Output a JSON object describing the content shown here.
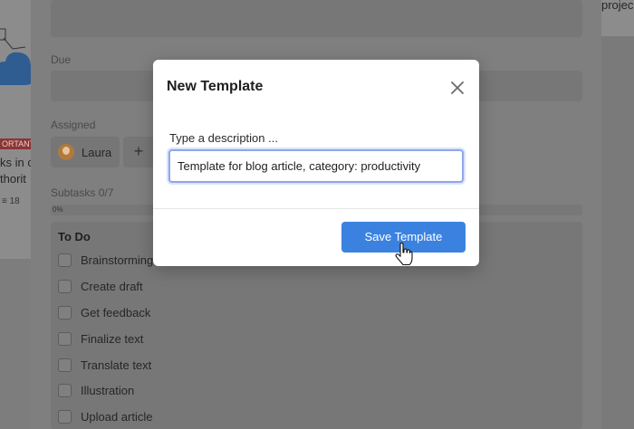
{
  "background": {
    "left_card": {
      "badge": "ORTANT",
      "text_line1": "ks in c",
      "text_line2": "thorit",
      "meta": "18"
    },
    "right_card": {
      "text": "projec"
    }
  },
  "task_panel": {
    "due_label": "Due",
    "assigned_label": "Assigned",
    "assignee_name": "Laura",
    "add_assignee": "+",
    "subtasks_label": "Subtasks 0/7",
    "progress_label": "0%",
    "progress_value": 0,
    "todo_title": "To Do",
    "todo_items": [
      "Brainstorming",
      "Create draft",
      "Get feedback",
      "Finalize text",
      "Translate text",
      "Illustration",
      "Upload article"
    ]
  },
  "modal": {
    "title": "New Template",
    "close_icon": "close-icon",
    "description_label": "Type a description ...",
    "description_value": "Template for blog article, category: productivity",
    "save_label": "Save Template"
  },
  "colors": {
    "primary": "#3b82e0",
    "focus_border": "#8ea8e8"
  }
}
